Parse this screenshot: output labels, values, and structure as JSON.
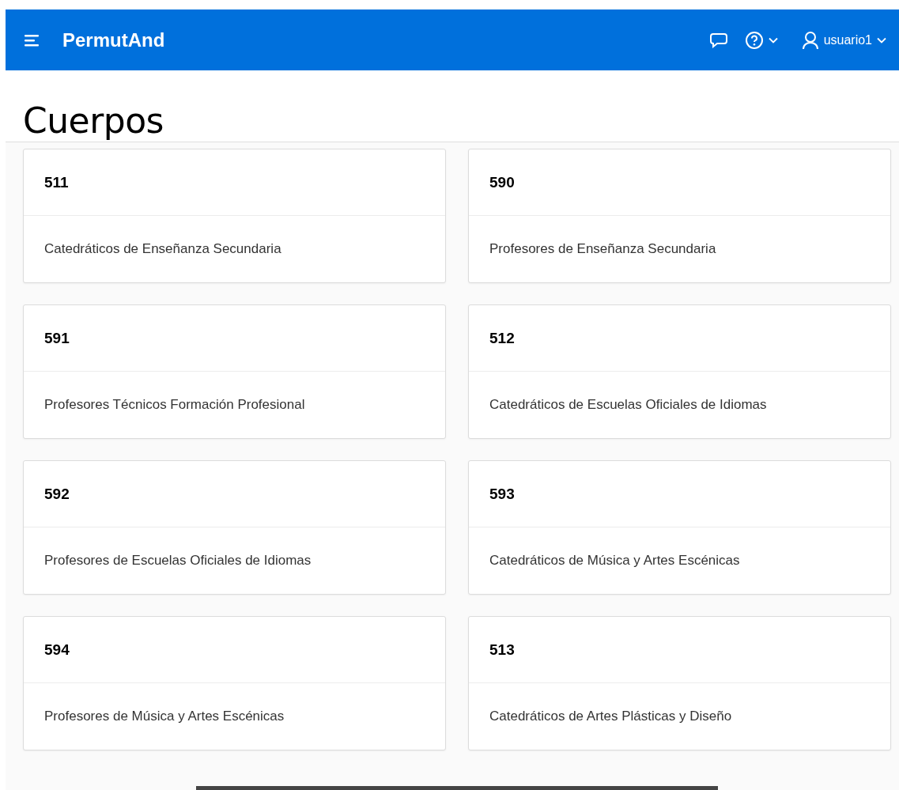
{
  "header": {
    "app_name": "PermutAnd",
    "user": "usuario1"
  },
  "page_title": "Cuerpos",
  "cards": [
    {
      "code": "511",
      "name": "Catedráticos de Enseñanza Secundaria"
    },
    {
      "code": "590",
      "name": "Profesores de Enseñanza Secundaria"
    },
    {
      "code": "591",
      "name": "Profesores Técnicos Formación Profesional"
    },
    {
      "code": "512",
      "name": "Catedráticos de Escuelas Oficiales de Idiomas"
    },
    {
      "code": "592",
      "name": "Profesores de Escuelas Oficiales de Idiomas"
    },
    {
      "code": "593",
      "name": "Catedráticos de Música y Artes Escénicas"
    },
    {
      "code": "594",
      "name": "Profesores de Música y Artes Escénicas"
    },
    {
      "code": "513",
      "name": "Catedráticos de Artes Plásticas y Diseño"
    }
  ]
}
